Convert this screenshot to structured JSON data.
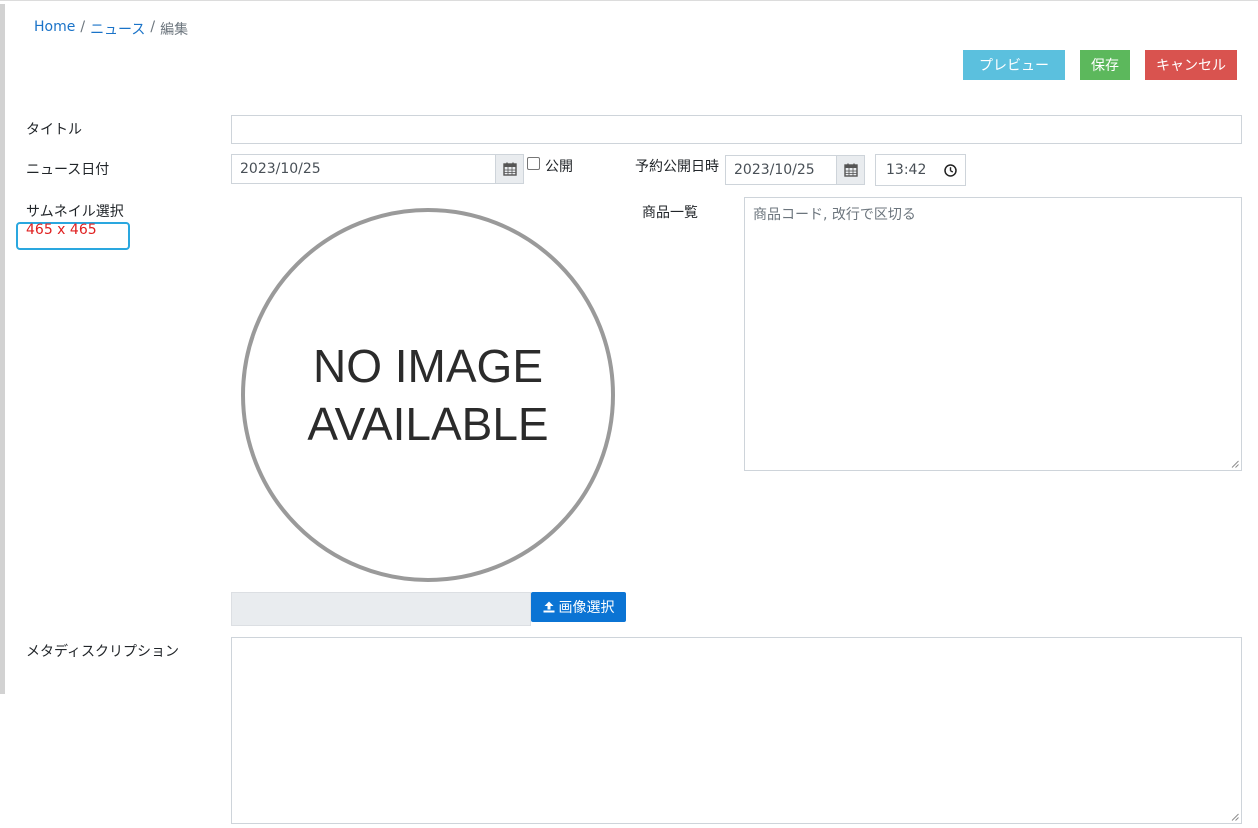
{
  "breadcrumb": {
    "home": "Home",
    "sep1": "/",
    "news": "ニュース",
    "sep2": "/",
    "current": "編集"
  },
  "toolbar": {
    "preview_label": "プレビュー",
    "save_label": "保存",
    "cancel_label": "キャンセル"
  },
  "form": {
    "title_label": "タイトル",
    "title_value": "",
    "news_date_label": "ニュース日付",
    "news_date_value": "2023/10/25",
    "publish_label": "公開",
    "scheduled_label": "予約公開日時",
    "scheduled_date_value": "2023/10/25",
    "scheduled_time_value": "13:42",
    "thumbnail_label": "サムネイル選択",
    "thumbnail_size": "465 x 465",
    "no_image_line1": "NO IMAGE",
    "no_image_line2": "AVAILABLE",
    "products_label": "商品一覧",
    "products_placeholder": "商品コード, 改行で区切る",
    "upload_label": "画像選択",
    "meta_label": "メタディスクリプション",
    "meta_value": ""
  },
  "colors": {
    "link": "#1a73c8",
    "preview": "#5bc0de",
    "save": "#5cb85c",
    "cancel": "#d9534f",
    "upload": "#0b74d4",
    "size_text": "#e02020",
    "highlight": "#2aa7df"
  },
  "icons": {
    "calendar": "calendar-icon",
    "clock": "clock-icon",
    "upload": "upload-icon"
  }
}
